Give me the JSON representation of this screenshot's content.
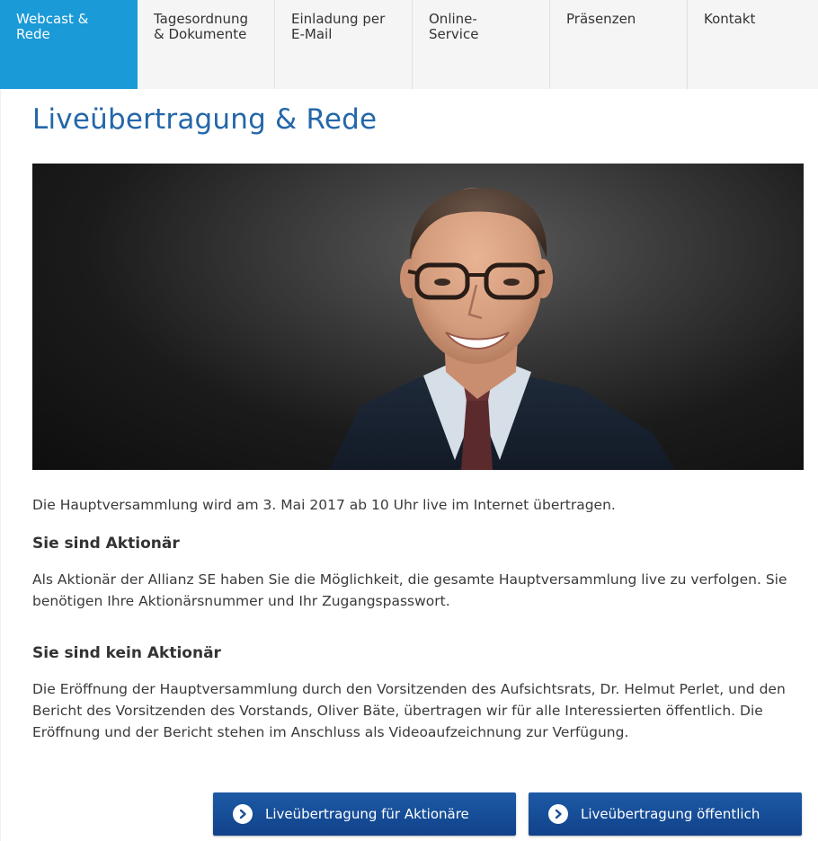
{
  "tabs": [
    {
      "label": "Webcast &\nRede",
      "active": true
    },
    {
      "label": "Tagesordnung\n& Dokumente",
      "active": false
    },
    {
      "label": "Einladung per\nE-Mail",
      "active": false
    },
    {
      "label": "Online-\nService",
      "active": false
    },
    {
      "label": "Präsenzen",
      "active": false
    },
    {
      "label": "Kontakt",
      "active": false
    }
  ],
  "page": {
    "title": "Liveübertragung & Rede",
    "intro": "Die Hauptversammlung wird am 3. Mai 2017 ab 10 Uhr live im Internet übertragen.",
    "section_shareholder": {
      "heading": "Sie sind Aktionär",
      "text": "Als Aktionär der Allianz SE haben Sie die Möglichkeit, die gesamte Hauptversammlung live zu verfolgen. Sie benötigen Ihre Aktionärsnummer und Ihr Zugangspasswort."
    },
    "section_public": {
      "heading": "Sie sind kein Aktionär",
      "text": "Die Eröffnung der Hauptversammlung durch den Vorsitzenden des Aufsichtsrats, Dr. Helmut Perlet, und den Bericht des Vorsitzenden des Vorstands, Oliver Bäte, übertragen wir für alle Interessierten öffentlich. Die Eröffnung und der Bericht stehen im Anschluss als Videoaufzeichnung zur Verfügung."
    }
  },
  "buttons": {
    "shareholders_label": "Liveübertragung für Aktionäre",
    "public_label": "Liveübertragung öffentlich",
    "icon": "chevron-right-circle-icon"
  },
  "colors": {
    "active_tab": "#1a9ad7",
    "title": "#2467a9",
    "button": "#1a4f98"
  }
}
